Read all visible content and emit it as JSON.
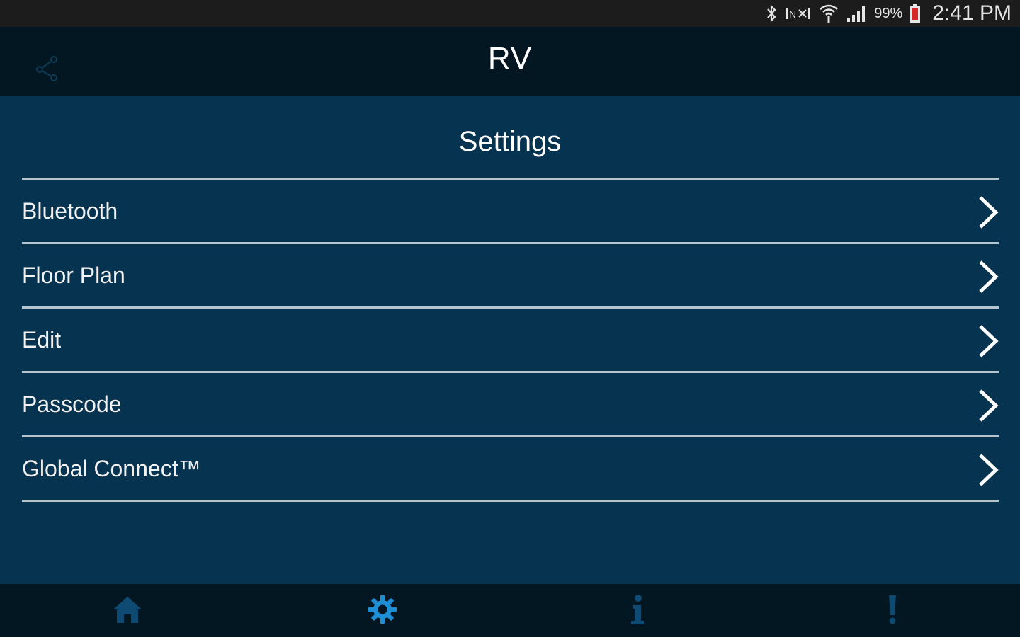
{
  "status_bar": {
    "icons": [
      "bluetooth-icon",
      "nfc-icon",
      "wifi-icon",
      "signal-icon",
      "battery-icon"
    ],
    "battery": "99%",
    "time": "2:41 PM"
  },
  "header": {
    "title": "RV",
    "left_icon": "share-icon"
  },
  "page": {
    "title": "Settings"
  },
  "menu": {
    "items": [
      {
        "label": "Bluetooth"
      },
      {
        "label": "Floor Plan"
      },
      {
        "label": "Edit"
      },
      {
        "label": "Passcode"
      },
      {
        "label": "Global Connect™"
      }
    ]
  },
  "bottom_nav": {
    "tabs": [
      {
        "icon": "home-icon",
        "active": false
      },
      {
        "icon": "gear-icon",
        "active": true
      },
      {
        "icon": "info-icon",
        "active": false
      },
      {
        "icon": "alert-icon",
        "active": false
      }
    ]
  },
  "colors": {
    "background": "#06334f",
    "header": "#021722",
    "status_bar": "#1c1c1c",
    "divider": "#b9c3cb",
    "active_tab": "#1e8fd6",
    "inactive_tab": "#0f4a72"
  }
}
